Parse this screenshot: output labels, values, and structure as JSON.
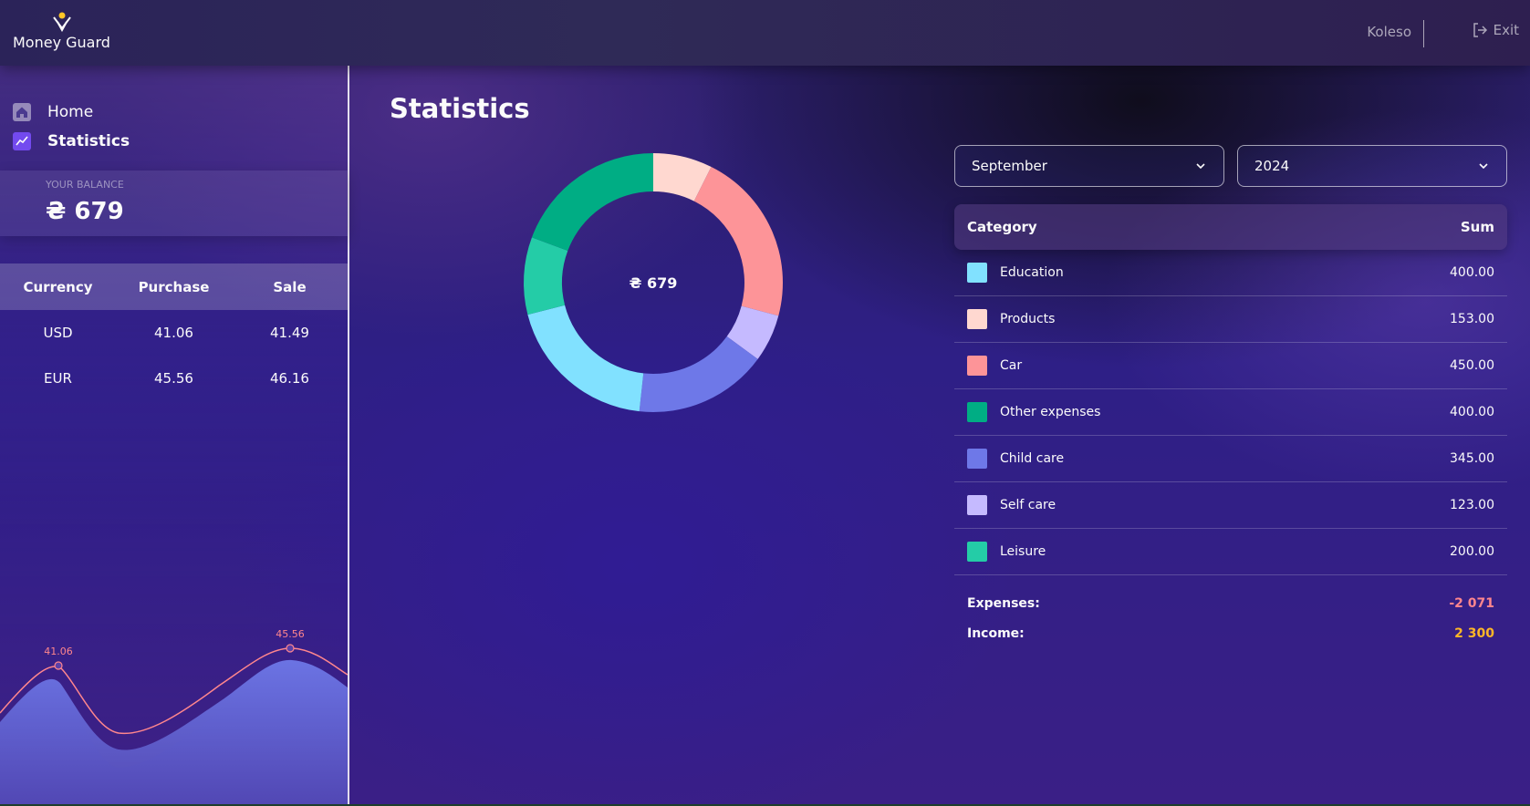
{
  "header": {
    "logo_text": "Money Guard",
    "user_name": "Koleso",
    "exit_label": "Exit"
  },
  "sidebar": {
    "nav": [
      {
        "label": "Home",
        "icon": "home-icon"
      },
      {
        "label": "Statistics",
        "icon": "statistics-icon",
        "active": true
      }
    ],
    "balance": {
      "label": "YOUR BALANCE",
      "value": "₴ 679"
    },
    "currency": {
      "headers": [
        "Currency",
        "Purchase",
        "Sale"
      ],
      "rows": [
        [
          "USD",
          "41.06",
          "41.49"
        ],
        [
          "EUR",
          "45.56",
          "46.16"
        ]
      ],
      "chart_labels": [
        "41.06",
        "45.56"
      ]
    }
  },
  "main": {
    "title": "Statistics",
    "donut_center": "₴ 679",
    "month_select": "September",
    "year_select": "2024",
    "table": {
      "headers": {
        "category": "Category",
        "sum": "Sum"
      },
      "rows": [
        {
          "name": "Education",
          "sum": "400.00",
          "color": "#81e1ff"
        },
        {
          "name": "Products",
          "sum": "153.00",
          "color": "#ffd8d0"
        },
        {
          "name": "Car",
          "sum": "450.00",
          "color": "#fd9498"
        },
        {
          "name": "Other expenses",
          "sum": "400.00",
          "color": "#00ad84"
        },
        {
          "name": "Child care",
          "sum": "345.00",
          "color": "#6e78e8"
        },
        {
          "name": "Self care",
          "sum": "123.00",
          "color": "#c5baff"
        },
        {
          "name": "Leisure",
          "sum": "200.00",
          "color": "#24cca7"
        }
      ],
      "expenses_label": "Expenses:",
      "expenses_value": "-2 071",
      "income_label": "Income:",
      "income_value": "2 300"
    }
  },
  "colors": {
    "accent": "#734aef",
    "expenses": "#ff868d",
    "income": "#ffb627",
    "chart_line": "#ff868d",
    "chart_fill": "#6e78e8"
  }
}
